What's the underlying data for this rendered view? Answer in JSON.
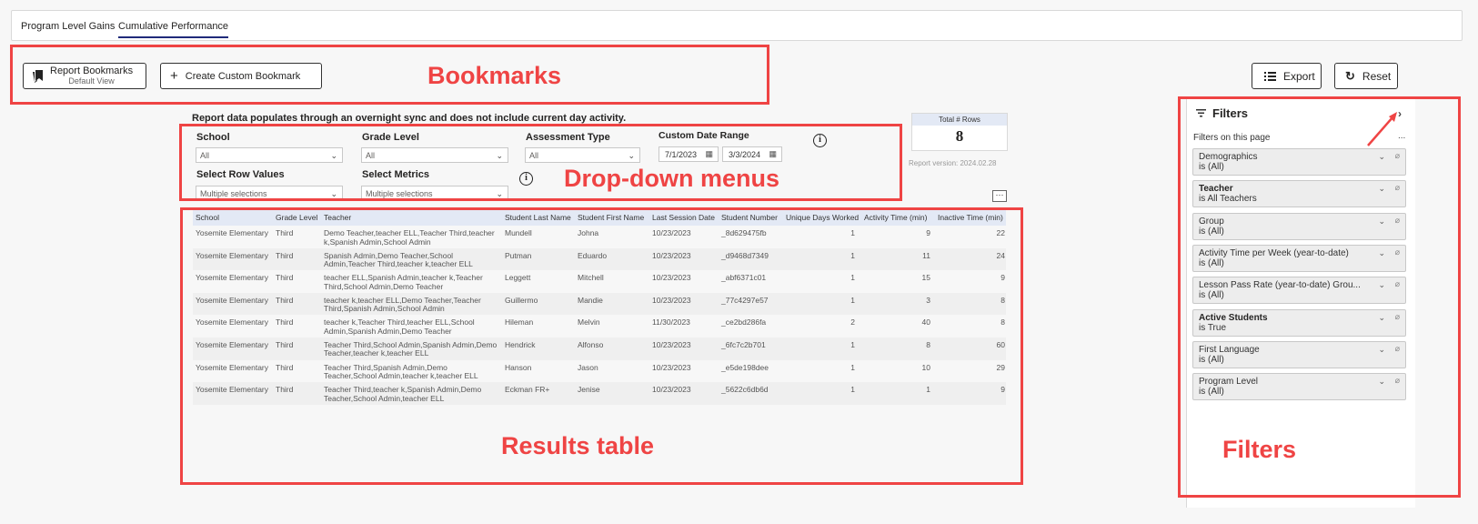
{
  "tabs": [
    {
      "label": "Program Level Gains",
      "active": false
    },
    {
      "label": "Cumulative Performance",
      "active": true
    }
  ],
  "toolbar": {
    "bookmarks_label": "Report Bookmarks",
    "bookmarks_sub": "Default View",
    "create_bookmark_label": "Create Custom Bookmark",
    "export_label": "Export",
    "reset_label": "Reset"
  },
  "annotations": {
    "bookmarks": "Bookmarks",
    "dropdowns": "Drop-down menus",
    "results": "Results table",
    "filters": "Filters"
  },
  "note": "Report data populates through an overnight sync and does not include current day activity.",
  "slicers": {
    "school": {
      "label": "School",
      "value": "All"
    },
    "grade": {
      "label": "Grade Level",
      "value": "All"
    },
    "assessment": {
      "label": "Assessment Type",
      "value": "All"
    },
    "date_range": {
      "label": "Custom Date Range",
      "start": "7/1/2023",
      "end": "3/3/2024"
    },
    "row_values": {
      "label": "Select Row Values",
      "value": "Multiple selections"
    },
    "metrics": {
      "label": "Select Metrics",
      "value": "Multiple selections"
    }
  },
  "total_rows": {
    "label": "Total # Rows",
    "value": "8"
  },
  "report_version": "Report version: 2024.02.28",
  "table": {
    "columns": [
      "School",
      "Grade Level",
      "Teacher",
      "Student Last Name",
      "Student First Name",
      "Last Session Date",
      "Student Number",
      "Unique Days Worked",
      "Activity Time (min)",
      "Inactive Time (min)"
    ],
    "rows": [
      [
        "Yosemite Elementary",
        "Third",
        "Demo Teacher,teacher ELL,Teacher Third,teacher k,Spanish Admin,School Admin",
        "Mundell",
        "Johna",
        "10/23/2023",
        "_8d629475fb",
        "1",
        "9",
        "22"
      ],
      [
        "Yosemite Elementary",
        "Third",
        "Spanish Admin,Demo Teacher,School Admin,Teacher Third,teacher k,teacher ELL",
        "Putman",
        "Eduardo",
        "10/23/2023",
        "_d9468d7349",
        "1",
        "11",
        "24"
      ],
      [
        "Yosemite Elementary",
        "Third",
        "teacher ELL,Spanish Admin,teacher k,Teacher Third,School Admin,Demo Teacher",
        "Leggett",
        "Mitchell",
        "10/23/2023",
        "_abf6371c01",
        "1",
        "15",
        "9"
      ],
      [
        "Yosemite Elementary",
        "Third",
        "teacher k,teacher ELL,Demo Teacher,Teacher Third,Spanish Admin,School Admin",
        "Guillermo",
        "Mandie",
        "10/23/2023",
        "_77c4297e57",
        "1",
        "3",
        "8"
      ],
      [
        "Yosemite Elementary",
        "Third",
        "teacher k,Teacher Third,teacher ELL,School Admin,Spanish Admin,Demo Teacher",
        "Hileman",
        "Melvin",
        "11/30/2023",
        "_ce2bd286fa",
        "2",
        "40",
        "8"
      ],
      [
        "Yosemite Elementary",
        "Third",
        "Teacher Third,School Admin,Spanish Admin,Demo Teacher,teacher k,teacher ELL",
        "Hendrick",
        "Alfonso",
        "10/23/2023",
        "_6fc7c2b701",
        "1",
        "8",
        "60"
      ],
      [
        "Yosemite Elementary",
        "Third",
        "Teacher Third,Spanish Admin,Demo Teacher,School Admin,teacher k,teacher ELL",
        "Hanson",
        "Jason",
        "10/23/2023",
        "_e5de198dee",
        "1",
        "10",
        "29"
      ],
      [
        "Yosemite Elementary",
        "Third",
        "Teacher Third,teacher k,Spanish Admin,Demo Teacher,School Admin,teacher ELL",
        "Eckman FR+",
        "Jenise",
        "10/23/2023",
        "_5622c6db6d",
        "1",
        "1",
        "9"
      ]
    ]
  },
  "filters": {
    "title": "Filters",
    "subtitle": "Filters on this page",
    "more": "...",
    "items": [
      {
        "name": "Demographics",
        "value": "is (All)",
        "bold": false
      },
      {
        "name": "Teacher",
        "value": "is All Teachers",
        "bold": true
      },
      {
        "name": "Group",
        "value": "is (All)",
        "bold": false
      },
      {
        "name": "Activity Time per Week (year-to-date)",
        "value": "is (All)",
        "bold": false
      },
      {
        "name": "Lesson Pass Rate (year-to-date) Grou...",
        "value": "is (All)",
        "bold": false
      },
      {
        "name": "Active Students",
        "value": "is True",
        "bold": true
      },
      {
        "name": "First Language",
        "value": "is (All)",
        "bold": false
      },
      {
        "name": "Program Level",
        "value": "is (All)",
        "bold": false
      }
    ]
  },
  "colors": {
    "annotation": "#ef4444",
    "tab_underline": "#1f2a7a",
    "header_bg": "#e3e9f5"
  }
}
